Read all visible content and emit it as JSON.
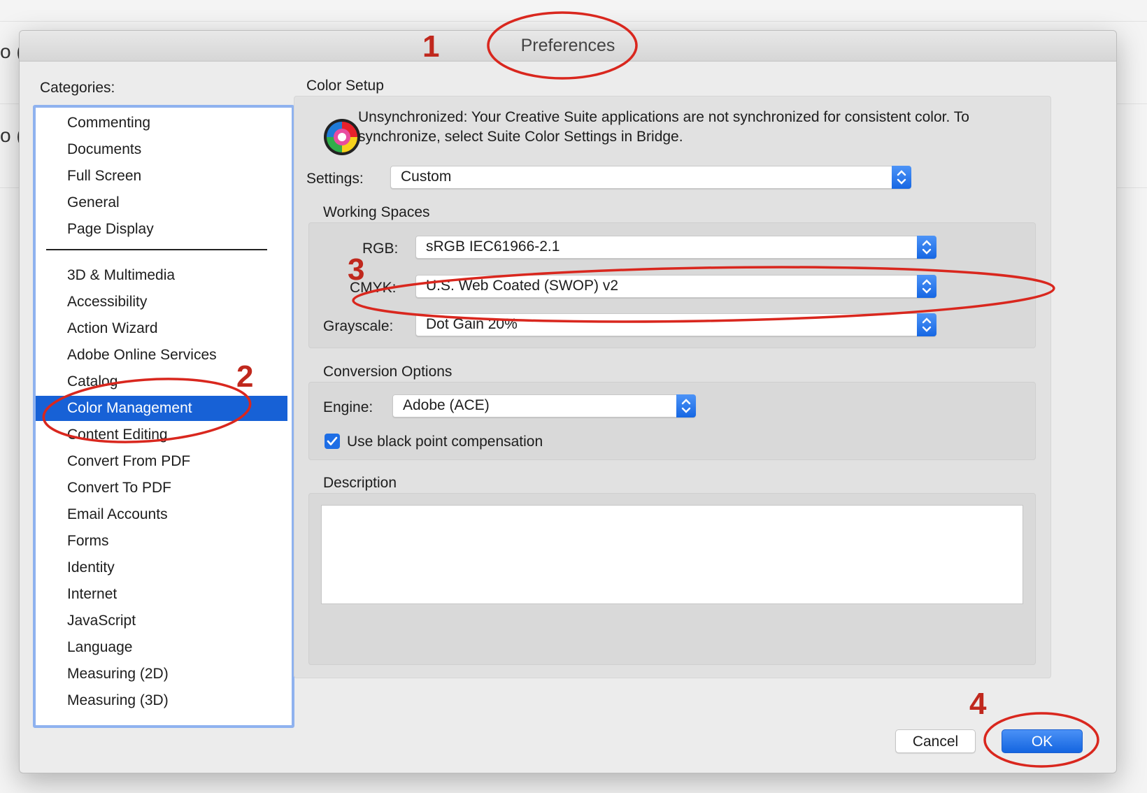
{
  "background": {
    "fragments": [
      "o (",
      "o ("
    ]
  },
  "dialog": {
    "title": "Preferences",
    "categories_label": "Categories:",
    "categories_top": [
      "Commenting",
      "Documents",
      "Full Screen",
      "General",
      "Page Display"
    ],
    "categories_bottom": [
      "3D & Multimedia",
      "Accessibility",
      "Action Wizard",
      "Adobe Online Services",
      "Catalog",
      "Color Management",
      "Content Editing",
      "Convert From PDF",
      "Convert To PDF",
      "Email Accounts",
      "Forms",
      "Identity",
      "Internet",
      "JavaScript",
      "Language",
      "Measuring (2D)",
      "Measuring (3D)"
    ],
    "selected_category": "Color Management"
  },
  "color_setup": {
    "heading": "Color Setup",
    "message": "Unsynchronized: Your Creative Suite applications are not synchronized for consistent color. To synchronize, select Suite Color Settings in Bridge.",
    "settings_label": "Settings:",
    "settings_value": "Custom",
    "working_spaces": {
      "heading": "Working Spaces",
      "rgb_label": "RGB:",
      "rgb_value": "sRGB IEC61966-2.1",
      "cmyk_label": "CMYK:",
      "cmyk_value": "U.S. Web Coated (SWOP) v2",
      "grayscale_label": "Grayscale:",
      "grayscale_value": "Dot Gain 20%"
    },
    "conversion": {
      "heading": "Conversion Options",
      "engine_label": "Engine:",
      "engine_value": "Adobe (ACE)",
      "black_point_label": "Use black point compensation",
      "black_point_checked": true
    },
    "description_heading": "Description",
    "description_text": ""
  },
  "buttons": {
    "cancel": "Cancel",
    "ok": "OK"
  },
  "annotations": {
    "n1": "1",
    "n2": "2",
    "n3": "3",
    "n4": "4"
  },
  "colors": {
    "accent": "#1761d6",
    "annotation": "#d9271e",
    "selection_border": "#8fb2ef"
  }
}
